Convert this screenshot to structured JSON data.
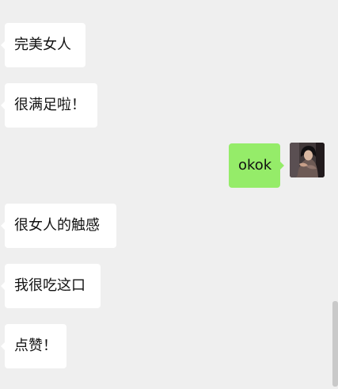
{
  "messages": [
    {
      "side": "left",
      "text": "完美女人"
    },
    {
      "side": "left",
      "text": "很满足啦！"
    },
    {
      "side": "right",
      "text": "okok",
      "avatar": "avatar-photo"
    },
    {
      "side": "left",
      "text": "很女人的触感"
    },
    {
      "side": "left",
      "text": "我很吃这口"
    },
    {
      "side": "left",
      "text": "点赞！"
    }
  ],
  "colors": {
    "background": "#efefef",
    "incoming_bubble": "#ffffff",
    "outgoing_bubble": "#95ec69",
    "scrollbar": "#c9c9c9"
  },
  "icons": {
    "avatar": "person-photo-thumbnail"
  }
}
